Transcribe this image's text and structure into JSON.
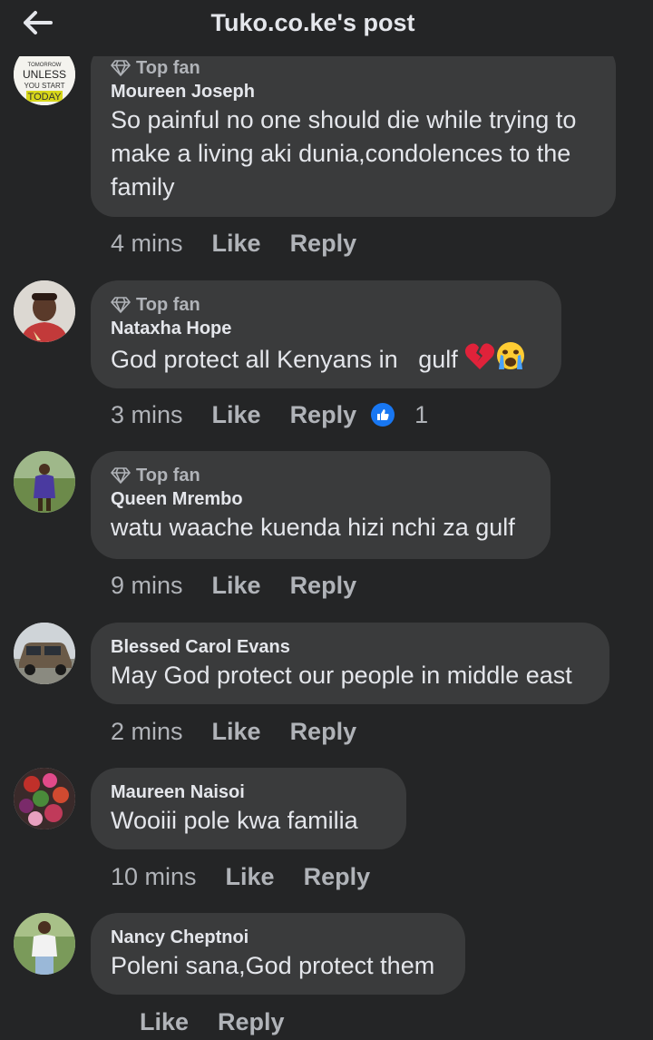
{
  "header": {
    "title": "Tuko.co.ke's post"
  },
  "comments": [
    {
      "badge": "Top fan",
      "author": "Moureen Joseph",
      "text": "So painful no one should die while trying to make a living aki dunia,condolences to the family",
      "time": "4 mins",
      "avatar_text": [
        "TOMORROW",
        "UNLESS",
        "YOU START",
        "TODAY"
      ]
    },
    {
      "badge": "Top fan",
      "author": "Nataxha Hope",
      "text": "God protect all Kenyans in   gulf",
      "time": "3 mins",
      "reaction_count": "1"
    },
    {
      "badge": "Top fan",
      "author": "Queen Mrembo",
      "text": "watu waache kuenda hizi nchi za gulf",
      "time": "9 mins"
    },
    {
      "author": "Blessed Carol Evans",
      "text": "May God protect our people in middle east",
      "time": "2 mins"
    },
    {
      "author": "Maureen Naisoi",
      "text": "Wooiii pole kwa familia",
      "time": "10 mins"
    },
    {
      "author": "Nancy Cheptnoi",
      "text": "Poleni sana,God protect them",
      "time": ""
    }
  ],
  "actions": {
    "like": "Like",
    "reply": "Reply"
  },
  "colors": {
    "background": "#242526",
    "bubble": "#3a3b3c",
    "text": "#e4e6eb",
    "muted": "#b0b3b8",
    "like_blue": "#1877f2"
  }
}
